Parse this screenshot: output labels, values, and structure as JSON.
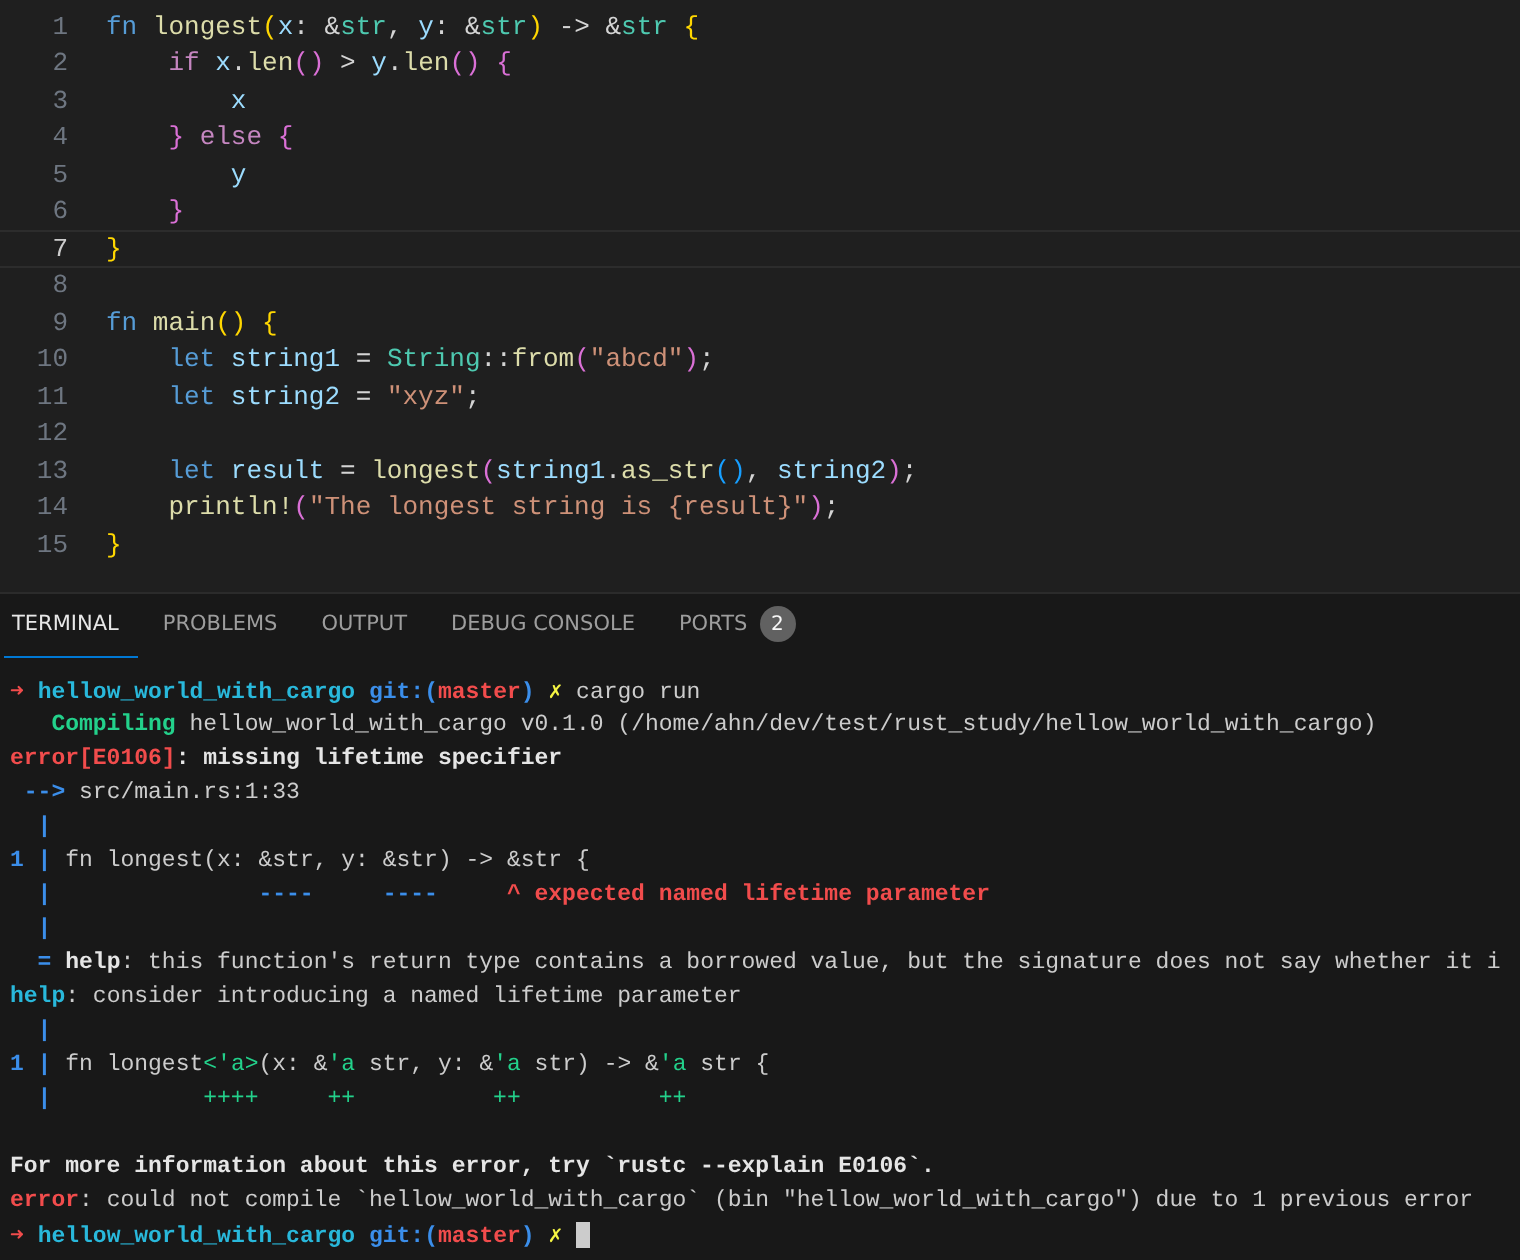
{
  "editor": {
    "lines": [
      {
        "number": "1",
        "current": false,
        "tokens": [
          {
            "t": "fn",
            "kind": "kw"
          },
          {
            "t": " longest",
            "kind": "fn"
          },
          {
            "t": "(",
            "kind": "b1"
          },
          {
            "t": "x",
            "kind": "var"
          },
          {
            "t": ": &",
            "kind": "p"
          },
          {
            "t": "str",
            "kind": "type"
          },
          {
            "t": ", ",
            "kind": "p"
          },
          {
            "t": "y",
            "kind": "var"
          },
          {
            "t": ": &",
            "kind": "p"
          },
          {
            "t": "str",
            "kind": "type"
          },
          {
            "t": ")",
            "kind": "b1"
          },
          {
            "t": " -> &",
            "kind": "p"
          },
          {
            "t": "str",
            "kind": "type"
          },
          {
            "t": " {",
            "kind": "b1"
          }
        ]
      },
      {
        "number": "2",
        "current": false,
        "tokens": [
          {
            "t": "    if",
            "kind": "ctl"
          },
          {
            "t": " x",
            "kind": "var"
          },
          {
            "t": ".",
            "kind": "p"
          },
          {
            "t": "len",
            "kind": "fn"
          },
          {
            "t": "()",
            "kind": "b2"
          },
          {
            "t": " > ",
            "kind": "p"
          },
          {
            "t": "y",
            "kind": "var"
          },
          {
            "t": ".",
            "kind": "p"
          },
          {
            "t": "len",
            "kind": "fn"
          },
          {
            "t": "()",
            "kind": "b2"
          },
          {
            "t": " {",
            "kind": "b2"
          }
        ]
      },
      {
        "number": "3",
        "current": false,
        "tokens": [
          {
            "t": "        x",
            "kind": "var"
          }
        ]
      },
      {
        "number": "4",
        "current": false,
        "tokens": [
          {
            "t": "    }",
            "kind": "b2"
          },
          {
            "t": " else",
            "kind": "ctl"
          },
          {
            "t": " {",
            "kind": "b2"
          }
        ]
      },
      {
        "number": "5",
        "current": false,
        "tokens": [
          {
            "t": "        y",
            "kind": "var"
          }
        ]
      },
      {
        "number": "6",
        "current": false,
        "tokens": [
          {
            "t": "    }",
            "kind": "b2"
          }
        ]
      },
      {
        "number": "7",
        "current": true,
        "tokens": [
          {
            "t": "}",
            "kind": "b1"
          }
        ]
      },
      {
        "number": "8",
        "current": false
      },
      {
        "number": "9",
        "current": false,
        "tokens": [
          {
            "t": "fn",
            "kind": "kw"
          },
          {
            "t": " main",
            "kind": "fn"
          },
          {
            "t": "()",
            "kind": "b1"
          },
          {
            "t": " {",
            "kind": "b1"
          }
        ]
      },
      {
        "number": "10",
        "current": false,
        "tokens": [
          {
            "t": "    let",
            "kind": "kw"
          },
          {
            "t": " string1",
            "kind": "var"
          },
          {
            "t": " = ",
            "kind": "p"
          },
          {
            "t": "String",
            "kind": "type"
          },
          {
            "t": "::",
            "kind": "p"
          },
          {
            "t": "from",
            "kind": "fn"
          },
          {
            "t": "(",
            "kind": "b2"
          },
          {
            "t": "\"abcd\"",
            "kind": "str"
          },
          {
            "t": ")",
            "kind": "b2"
          },
          {
            "t": ";",
            "kind": "p"
          }
        ]
      },
      {
        "number": "11",
        "current": false,
        "tokens": [
          {
            "t": "    let",
            "kind": "kw"
          },
          {
            "t": " string2",
            "kind": "var"
          },
          {
            "t": " = ",
            "kind": "p"
          },
          {
            "t": "\"xyz\"",
            "kind": "str"
          },
          {
            "t": ";",
            "kind": "p"
          }
        ]
      },
      {
        "number": "12",
        "current": false
      },
      {
        "number": "13",
        "current": false,
        "tokens": [
          {
            "t": "    let",
            "kind": "kw"
          },
          {
            "t": " result",
            "kind": "var"
          },
          {
            "t": " = ",
            "kind": "p"
          },
          {
            "t": "longest",
            "kind": "fn"
          },
          {
            "t": "(",
            "kind": "b2"
          },
          {
            "t": "string1",
            "kind": "var"
          },
          {
            "t": ".",
            "kind": "p"
          },
          {
            "t": "as_str",
            "kind": "fn"
          },
          {
            "t": "()",
            "kind": "b3"
          },
          {
            "t": ", ",
            "kind": "p"
          },
          {
            "t": "string2",
            "kind": "var"
          },
          {
            "t": ")",
            "kind": "b2"
          },
          {
            "t": ";",
            "kind": "p"
          }
        ]
      },
      {
        "number": "14",
        "current": false,
        "tokens": [
          {
            "t": "    println!",
            "kind": "fn"
          },
          {
            "t": "(",
            "kind": "b2"
          },
          {
            "t": "\"The longest string is {result}\"",
            "kind": "str"
          },
          {
            "t": ")",
            "kind": "b2"
          },
          {
            "t": ";",
            "kind": "p"
          }
        ]
      },
      {
        "number": "15",
        "current": false,
        "tokens": [
          {
            "t": "}",
            "kind": "b1"
          }
        ]
      }
    ]
  },
  "panel": {
    "tabs": [
      {
        "label": "TERMINAL",
        "selected": true
      },
      {
        "label": "PROBLEMS",
        "selected": false
      },
      {
        "label": "OUTPUT",
        "selected": false
      },
      {
        "label": "DEBUG CONSOLE",
        "selected": false
      },
      {
        "label": "PORTS",
        "selected": false,
        "badge": "2"
      }
    ]
  },
  "terminal": {
    "lines": [
      {
        "segments": [
          {
            "t": "➜ ",
            "kind": "red-bold"
          },
          {
            "t": "hellow_world_with_cargo",
            "kind": "cyan-bold"
          },
          {
            "t": " git:(",
            "kind": "blue-bold"
          },
          {
            "t": "master",
            "kind": "red-bold"
          },
          {
            "t": ")",
            "kind": "blue-bold"
          },
          {
            "t": " ✗",
            "kind": "yellow-bold"
          },
          {
            "t": " cargo run",
            "kind": "plain"
          }
        ]
      },
      {
        "segments": [
          {
            "t": "   Compiling",
            "kind": "green-bold"
          },
          {
            "t": " hellow_world_with_cargo v0.1.0 (/home/ahn/dev/test/rust_study/hellow_world_with_cargo)",
            "kind": "plain"
          }
        ]
      },
      {
        "segments": [
          {
            "t": "error[E0106]",
            "kind": "red-bold"
          },
          {
            "t": ": missing lifetime specifier",
            "kind": "bold"
          }
        ]
      },
      {
        "segments": [
          {
            "t": " -->",
            "kind": "blue-bold"
          },
          {
            "t": " src/main.rs:1:33",
            "kind": "plain"
          }
        ]
      },
      {
        "segments": [
          {
            "t": "  |",
            "kind": "blue-bold"
          }
        ]
      },
      {
        "segments": [
          {
            "t": "1 |",
            "kind": "blue-bold"
          },
          {
            "t": " fn longest(x: &str, y: &str) -> &str {",
            "kind": "plain"
          }
        ]
      },
      {
        "segments": [
          {
            "t": "  |               ----     ----",
            "kind": "blue-bold"
          },
          {
            "t": "     ^ expected named lifetime parameter",
            "kind": "red-bold"
          }
        ]
      },
      {
        "segments": [
          {
            "t": "  |",
            "kind": "blue-bold"
          }
        ]
      },
      {
        "segments": [
          {
            "t": "  = ",
            "kind": "blue-bold"
          },
          {
            "t": "help",
            "kind": "bold"
          },
          {
            "t": ": this function's return type contains a borrowed value, but the signature does not say whether it i",
            "kind": "plain"
          }
        ]
      },
      {
        "segments": [
          {
            "t": "help",
            "kind": "cyan-bold"
          },
          {
            "t": ": consider introducing a named lifetime parameter",
            "kind": "plain"
          }
        ]
      },
      {
        "segments": [
          {
            "t": "  |",
            "kind": "blue-bold"
          }
        ]
      },
      {
        "segments": [
          {
            "t": "1 |",
            "kind": "blue-bold"
          },
          {
            "t": " fn longest",
            "kind": "plain"
          },
          {
            "t": "<'a>",
            "kind": "green"
          },
          {
            "t": "(x: &",
            "kind": "plain"
          },
          {
            "t": "'a",
            "kind": "green"
          },
          {
            "t": " str, y: &",
            "kind": "plain"
          },
          {
            "t": "'a",
            "kind": "green"
          },
          {
            "t": " str) -> &",
            "kind": "plain"
          },
          {
            "t": "'a",
            "kind": "green"
          },
          {
            "t": " str {",
            "kind": "plain"
          }
        ]
      },
      {
        "segments": [
          {
            "t": "  |",
            "kind": "blue-bold"
          },
          {
            "t": "           ++++     ++          ++          ++",
            "kind": "green"
          }
        ]
      },
      {
        "space_before": true,
        "segments": [
          {
            "t": "For more information about this error, try `rustc --explain E0106`.",
            "kind": "bold"
          }
        ]
      },
      {
        "segments": [
          {
            "t": "error",
            "kind": "red-bold"
          },
          {
            "t": ": could not compile `hellow_world_with_cargo` (bin \"hellow_world_with_cargo\") due to 1 previous error",
            "kind": "plain"
          }
        ]
      },
      {
        "segments": [
          {
            "t": "➜ ",
            "kind": "red-bold"
          },
          {
            "t": "hellow_world_with_cargo",
            "kind": "cyan-bold"
          },
          {
            "t": " git:(",
            "kind": "blue-bold"
          },
          {
            "t": "master",
            "kind": "red-bold"
          },
          {
            "t": ")",
            "kind": "blue-bold"
          },
          {
            "t": " ✗",
            "kind": "yellow-bold"
          }
        ],
        "cursor": true
      }
    ]
  }
}
